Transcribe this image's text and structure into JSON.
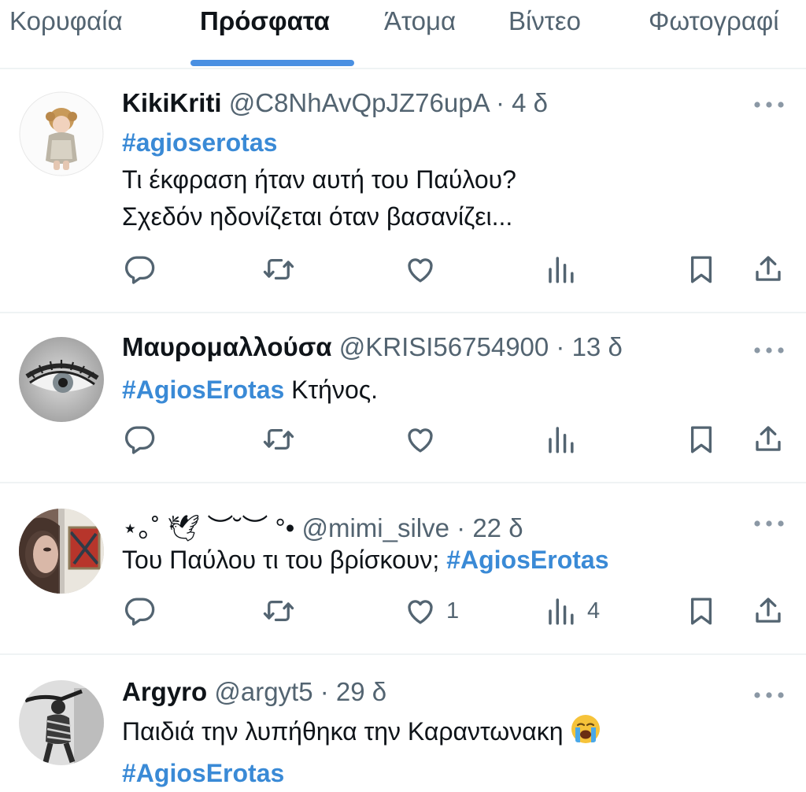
{
  "tabs": [
    {
      "label": "Κορυφαία"
    },
    {
      "label": "Πρόσφατα"
    },
    {
      "label": "Άτομα"
    },
    {
      "label": "Βίντεο"
    },
    {
      "label": "Φωτογραφί"
    }
  ],
  "active_tab": "Πρόσφατα",
  "colors": {
    "accent": "#4a90e2",
    "hashtag": "#3a8ad6",
    "secondary_text": "#536471",
    "divider": "#eff3f4"
  },
  "tweets": [
    {
      "name": "KikiKriti",
      "handle": "@C8NhAvQpJZ76upA",
      "time": "· 4 δ",
      "lines": [
        {
          "tag": "#agioserotas"
        },
        {
          "text": "Τι έκφραση ήταν αυτή του Παύλου?"
        },
        {
          "text": "Σχεδόν ηδονίζεται όταν βασανίζει..."
        }
      ],
      "likes": "",
      "views": ""
    },
    {
      "name": "Μαυρομαλλούσα",
      "handle": "@KRISI56754900",
      "time": "· 13 δ",
      "lines": [
        {
          "tag": "#AgiosErotas",
          "text": " Κτήνος."
        }
      ],
      "likes": "",
      "views": ""
    },
    {
      "name": "⋆｡˚ 🕊︎ ︶˘︶ °•",
      "handle": "@mimi_silve",
      "time": "· 22 δ",
      "lines": [
        {
          "text": "Του Παύλου τι του βρίσκουν; ",
          "tag": "#AgiosErotas"
        }
      ],
      "likes": "1",
      "views": "4"
    },
    {
      "name": "Argyro",
      "handle": "@argyt5",
      "time": "· 29 δ",
      "lines": [
        {
          "text": "Παιδιά την λυπήθηκα την Καραντωνακη ",
          "emoji": "loudly-crying-face-emoji"
        },
        {
          "tag": "#AgiosErotas"
        }
      ]
    }
  ],
  "icons": [
    "reply-icon",
    "retweet-icon",
    "like-icon",
    "views-icon",
    "bookmark-icon",
    "share-icon",
    "more-icon"
  ]
}
